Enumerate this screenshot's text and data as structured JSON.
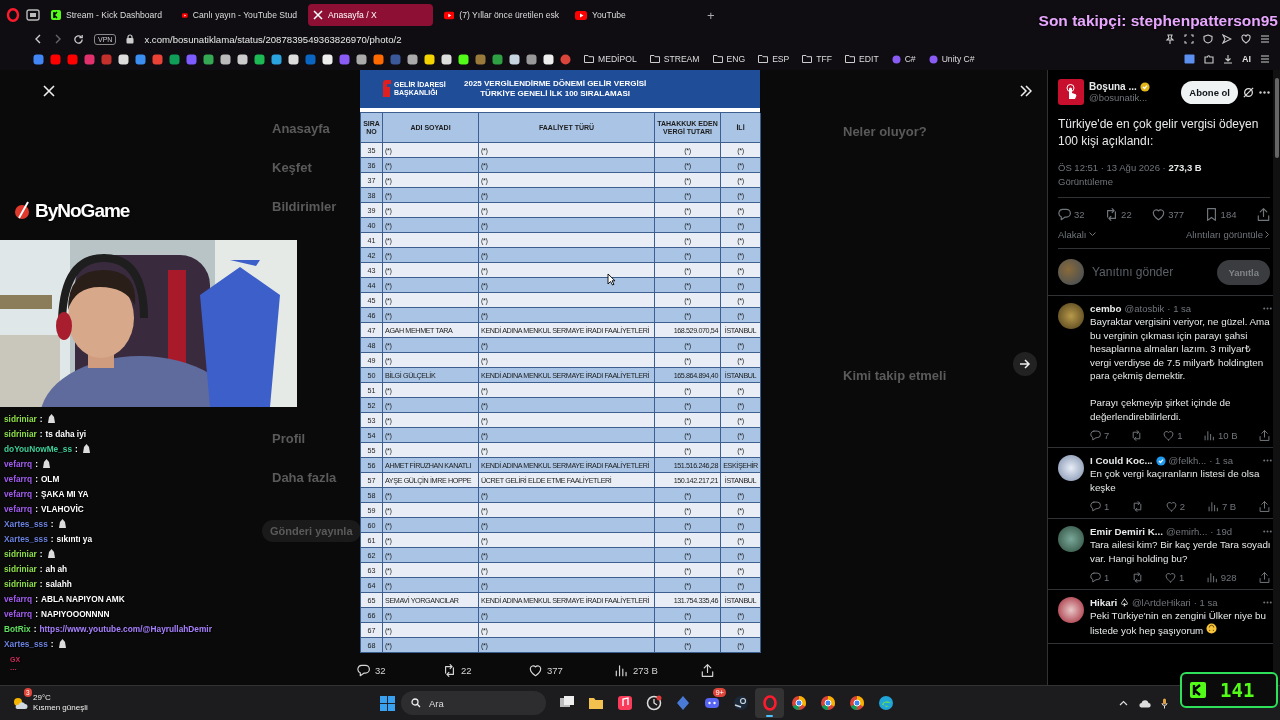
{
  "browser": {
    "tabs": [
      {
        "label": "Stream - Kick Dashboard",
        "kind": "kick",
        "selected": false
      },
      {
        "label": "Canlı yayın - YouTube Stud",
        "kind": "youtube",
        "selected": false
      },
      {
        "label": "Anasayfa / X",
        "kind": "x",
        "selected": true
      },
      {
        "label": "(7) Yıllar önce üretilen esk",
        "kind": "youtube",
        "selected": false
      },
      {
        "label": "YouTube",
        "kind": "youtube",
        "selected": false
      }
    ],
    "new_tab": "+",
    "vpn": "VPN",
    "address": "x.com/bosunatiklama/status/2087839549363826970/photo/2",
    "ai_button": "AI",
    "bookmarks": [
      {
        "label": "MEDİPOL",
        "kind": "folder"
      },
      {
        "label": "STREAM",
        "kind": "folder"
      },
      {
        "label": "ENG",
        "kind": "folder"
      },
      {
        "label": "ESP",
        "kind": "folder"
      },
      {
        "label": "TFF",
        "kind": "folder"
      },
      {
        "label": "EDIT",
        "kind": "folder"
      },
      {
        "label": "C#",
        "kind": "link"
      },
      {
        "label": "Unity C#",
        "kind": "link"
      }
    ]
  },
  "background_page": {
    "nav": [
      "Anasayfa",
      "Keşfet",
      "Bildirimler",
      "Profil",
      "Daha fazla"
    ],
    "post_button": "Gönderi yayınla",
    "headings": [
      "Neler oluyor?",
      "Kimi takip etmeli"
    ]
  },
  "viewer": {
    "document": {
      "org": [
        "GELİR İDARESİ",
        "BAŞKANLIĞI"
      ],
      "title": [
        "2025 VERGİLENDİRME DÖNEMİ GELİR VERGİSİ",
        "TÜRKİYE GENELİ İLK 100 SIRALAMASI"
      ],
      "columns": [
        "SIRA NO",
        "ADI SOYADI",
        "FAALİYET TÜRÜ",
        "TAHAKKUK EDEN VERGİ TUTARI",
        "İLİ"
      ],
      "rows": [
        [
          "35",
          "(*)",
          "(*)",
          "(*)",
          "(*)"
        ],
        [
          "36",
          "(*)",
          "(*)",
          "(*)",
          "(*)"
        ],
        [
          "37",
          "(*)",
          "(*)",
          "(*)",
          "(*)"
        ],
        [
          "38",
          "(*)",
          "(*)",
          "(*)",
          "(*)"
        ],
        [
          "39",
          "(*)",
          "(*)",
          "(*)",
          "(*)"
        ],
        [
          "40",
          "(*)",
          "(*)",
          "(*)",
          "(*)"
        ],
        [
          "41",
          "(*)",
          "(*)",
          "(*)",
          "(*)"
        ],
        [
          "42",
          "(*)",
          "(*)",
          "(*)",
          "(*)"
        ],
        [
          "43",
          "(*)",
          "(*)",
          "(*)",
          "(*)"
        ],
        [
          "44",
          "(*)",
          "(*)",
          "(*)",
          "(*)"
        ],
        [
          "45",
          "(*)",
          "(*)",
          "(*)",
          "(*)"
        ],
        [
          "46",
          "(*)",
          "(*)",
          "(*)",
          "(*)"
        ],
        [
          "47",
          "AGAH MEHMET TARA",
          "KENDİ ADINA MENKUL SERMAYE İRADI FAALİYETLERİ",
          "168.529.070,54",
          "İSTANBUL"
        ],
        [
          "48",
          "(*)",
          "(*)",
          "(*)",
          "(*)"
        ],
        [
          "49",
          "(*)",
          "(*)",
          "(*)",
          "(*)"
        ],
        [
          "50",
          "BİLGİ GÜLÇELİK",
          "KENDİ ADINA MENKUL SERMAYE İRADI FAALİYETLERİ",
          "165.864.894,40",
          "İSTANBUL"
        ],
        [
          "51",
          "(*)",
          "(*)",
          "(*)",
          "(*)"
        ],
        [
          "52",
          "(*)",
          "(*)",
          "(*)",
          "(*)"
        ],
        [
          "53",
          "(*)",
          "(*)",
          "(*)",
          "(*)"
        ],
        [
          "54",
          "(*)",
          "(*)",
          "(*)",
          "(*)"
        ],
        [
          "55",
          "(*)",
          "(*)",
          "(*)",
          "(*)"
        ],
        [
          "56",
          "AHMET FİRUZHAN KANATLI",
          "KENDİ ADINA MENKUL SERMAYE İRADI FAALİYETLERİ",
          "151.516.246,28",
          "ESKİŞEHİR"
        ],
        [
          "57",
          "AYŞE GÜLÇİN İMRE HOPPE",
          "ÜCRET GELİRİ ELDE ETME FAALİYETLERİ",
          "150.142.217,21",
          "İSTANBUL"
        ],
        [
          "58",
          "(*)",
          "(*)",
          "(*)",
          "(*)"
        ],
        [
          "59",
          "(*)",
          "(*)",
          "(*)",
          "(*)"
        ],
        [
          "60",
          "(*)",
          "(*)",
          "(*)",
          "(*)"
        ],
        [
          "61",
          "(*)",
          "(*)",
          "(*)",
          "(*)"
        ],
        [
          "62",
          "(*)",
          "(*)",
          "(*)",
          "(*)"
        ],
        [
          "63",
          "(*)",
          "(*)",
          "(*)",
          "(*)"
        ],
        [
          "64",
          "(*)",
          "(*)",
          "(*)",
          "(*)"
        ],
        [
          "65",
          "SEMAVİ YORGANCILAR",
          "KENDİ ADINA MENKUL SERMAYE İRADI FAALİYETLERİ",
          "131.754.335,46",
          "İSTANBUL"
        ],
        [
          "66",
          "(*)",
          "(*)",
          "(*)",
          "(*)"
        ],
        [
          "67",
          "(*)",
          "(*)",
          "(*)",
          "(*)"
        ],
        [
          "68",
          "(*)",
          "(*)",
          "(*)",
          "(*)"
        ]
      ]
    },
    "actions": [
      {
        "kind": "reply",
        "count": "32"
      },
      {
        "kind": "repost",
        "count": "22"
      },
      {
        "kind": "like",
        "count": "377"
      },
      {
        "kind": "views",
        "count": "273 B"
      },
      {
        "kind": "share"
      }
    ]
  },
  "post": {
    "author": "Boşuna ...",
    "verified": {
      "color": "#e2b719"
    },
    "handle": "@bosunatik...",
    "follow_button": "Abone ol",
    "text": "Türkiye'de en çok gelir vergisi ödeyen 100 kişi açıklandı:",
    "time": "ÖS 12:51 · 13 Ağu 2026 ·",
    "views": "273,3 B",
    "views_label": "Görüntüleme",
    "stats": [
      {
        "kind": "reply",
        "count": "32"
      },
      {
        "kind": "repost",
        "count": "22"
      },
      {
        "kind": "like",
        "count": "377"
      },
      {
        "kind": "bookmark",
        "count": "184"
      },
      {
        "kind": "share"
      }
    ],
    "sort": "Alakalı",
    "quotes_link": "Alıntıları görüntüle",
    "reply_placeholder": "Yanıtını gönder",
    "reply_button": {
      "label": "Yanıtla",
      "disabled": true
    }
  },
  "replies": [
    {
      "name": "cembo",
      "handle": "@atosbik",
      "time": "· 1 sa",
      "text": "Bayraktar vergisini veriyor, ne güzel. Ama bu verginin çıkması için parayı şahsi hesaplarına almaları lazım. 3 milyar₺ vergi verdiyse de 7.5 milyar₺ holdingten para çekmiş demektir.\n\nParayı çekmeyip şirket içinde de değerlendirebilirlerdi.",
      "replies": "7",
      "likes": "1",
      "views": "10 B"
    },
    {
      "name": "I Could Koc...",
      "verified": {
        "color": "#1d9bf0"
      },
      "handle": "@felkh...",
      "time": "· 1 sa",
      "text": "En çok vergi kaçıranların listesi de olsa keşke",
      "replies": "1",
      "likes": "2",
      "views": "7 B"
    },
    {
      "name": "Emir Demiri K...",
      "handle": "@emirh...",
      "time": "· 19d",
      "text": "Tara ailesi kim? Bir kaç yerde Tara soyadı var. Hangi holding bu?",
      "replies": "1",
      "likes": "1",
      "views": "928"
    },
    {
      "name": "Hikari ♤",
      "handle": "@lArtdeHikari",
      "time": "· 1 sa",
      "text": "Peki Türkiye'nin en zengini Ülker niye bu listede yok hep şaşıyorum",
      "emoji_end": true
    }
  ],
  "stream_overlay": {
    "brand": "ByNoGame",
    "last_follower": "Son takipçi: stephenpatterson95",
    "viewer_count": "141",
    "chat_footer": "GX",
    "chat_more": "...",
    "chat": [
      {
        "user": "sidriniar",
        "sep": ":",
        "kind": "emote",
        "color": "#8ee04a"
      },
      {
        "user": "sidriniar",
        "sep": ":",
        "kind": "text",
        "text": "ts daha iyi",
        "color": "#8ee04a"
      },
      {
        "user": "doYouNowMe_ss",
        "sep": ":",
        "kind": "emote",
        "color": "#3fcf9a"
      },
      {
        "user": "vefarrq",
        "sep": ":",
        "kind": "emote",
        "color": "#a25cf0"
      },
      {
        "user": "vefarrq",
        "sep": ":",
        "kind": "text",
        "text": "OLM",
        "color": "#a25cf0"
      },
      {
        "user": "vefarrq",
        "sep": ":",
        "kind": "text",
        "text": "ŞAKA MI YA",
        "color": "#a25cf0"
      },
      {
        "user": "vefarrq",
        "sep": ":",
        "kind": "text",
        "text": "VLAHOVİC",
        "color": "#a25cf0"
      },
      {
        "user": "Xartes_sss",
        "sep": ":",
        "kind": "emote",
        "color": "#6b82e0"
      },
      {
        "user": "Xartes_sss",
        "sep": ":",
        "kind": "text",
        "text": "sıkıntı ya",
        "color": "#6b82e0"
      },
      {
        "user": "sidriniar",
        "sep": ":",
        "kind": "emote",
        "color": "#8ee04a"
      },
      {
        "user": "sidriniar",
        "sep": ":",
        "kind": "text",
        "text": "ah ah",
        "color": "#8ee04a"
      },
      {
        "user": "sidriniar",
        "sep": ":",
        "kind": "text",
        "text": "salahh",
        "color": "#8ee04a"
      },
      {
        "user": "vefarrq",
        "sep": ":",
        "kind": "text",
        "text": "ABLA NAPIYON AMK",
        "color": "#a25cf0"
      },
      {
        "user": "vefarrq",
        "sep": ":",
        "kind": "text",
        "text": "NAPIYOOONNNN",
        "color": "#a25cf0"
      },
      {
        "user": "BotRix",
        "sep": ":",
        "kind": "link",
        "text": "https://www.youtube.com/@HayrullahDemir",
        "color": "#5ee05e"
      },
      {
        "user": "Xartes_sss",
        "sep": ":",
        "kind": "emote",
        "color": "#6b82e0"
      }
    ]
  },
  "taskbar": {
    "weather": {
      "temp": "29°C",
      "condition": "Kısmen güneşli",
      "badge": "3"
    },
    "search": "Ara",
    "apps": [
      {
        "kind": "taskview",
        "selected": false
      },
      {
        "kind": "folder",
        "selected": false
      },
      {
        "kind": "music",
        "selected": false
      },
      {
        "kind": "clock",
        "selected": false
      },
      {
        "kind": "diamond",
        "selected": false
      },
      {
        "kind": "chat",
        "badge": "9+",
        "selected": false
      },
      {
        "kind": "steam",
        "selected": false
      },
      {
        "kind": "opera",
        "selected": true
      },
      {
        "kind": "chrome",
        "selected": false
      },
      {
        "kind": "chrome",
        "selected": false
      },
      {
        "kind": "chrome",
        "selected": false
      },
      {
        "kind": "edge",
        "selected": false
      }
    ]
  }
}
